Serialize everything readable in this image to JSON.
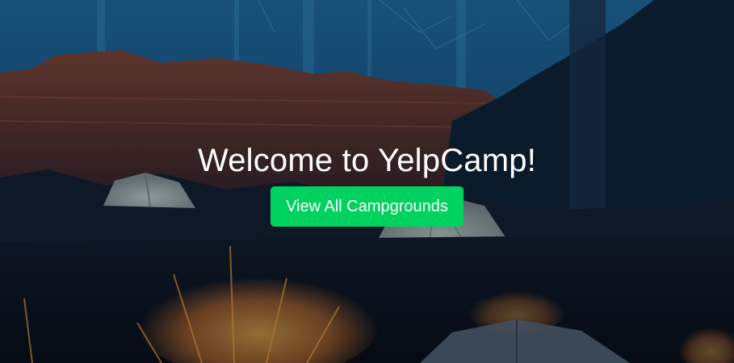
{
  "hero": {
    "title": "Welcome to YelpCamp!",
    "cta_label": "View All Campgrounds"
  },
  "colors": {
    "cta_background": "#00d25f",
    "title_text": "#ffffff",
    "sky": "#1a5a86",
    "night": "#07111f"
  }
}
